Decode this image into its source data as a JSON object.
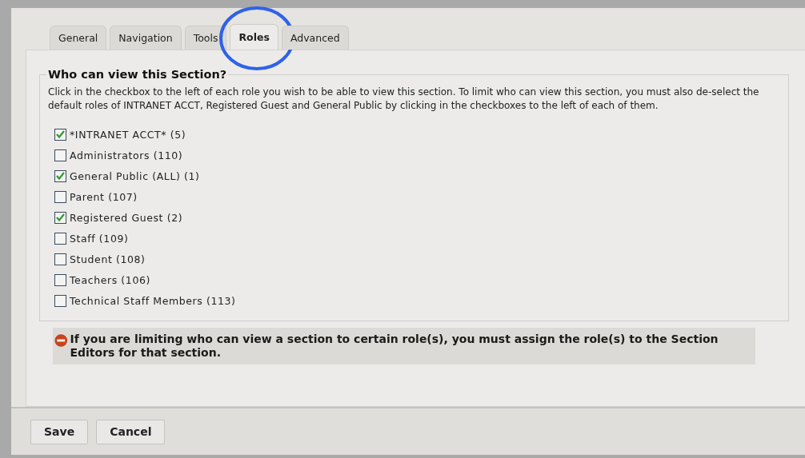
{
  "tabs": [
    {
      "label": "General",
      "selected": false,
      "circled": false
    },
    {
      "label": "Navigation",
      "selected": false,
      "circled": false
    },
    {
      "label": "Tools",
      "selected": false,
      "circled": false
    },
    {
      "label": "Roles",
      "selected": true,
      "circled": true
    },
    {
      "label": "Advanced",
      "selected": false,
      "circled": false
    }
  ],
  "section": {
    "legend": "Who can view this Section?",
    "description": "Click in the checkbox to the left of each role you wish to be able to view this section. To limit who can view this section, you must also de-select the default roles of INTRANET ACCT, Registered Guest and General Public by clicking in the checkboxes to the left of each of them.",
    "roles": [
      {
        "label": "*INTRANET ACCT* (5)",
        "checked": true
      },
      {
        "label": "Administrators (110)",
        "checked": false
      },
      {
        "label": "General Public (ALL) (1)",
        "checked": true
      },
      {
        "label": "Parent (107)",
        "checked": false
      },
      {
        "label": "Registered Guest (2)",
        "checked": true
      },
      {
        "label": "Staff (109)",
        "checked": false
      },
      {
        "label": "Student (108)",
        "checked": false
      },
      {
        "label": "Teachers (106)",
        "checked": false
      },
      {
        "label": "Technical Staff Members (113)",
        "checked": false
      }
    ]
  },
  "notice": "If you are limiting who can view a section to certain role(s), you must assign the role(s) to the Section Editors for that section.",
  "buttons": [
    "Save",
    "Cancel"
  ]
}
